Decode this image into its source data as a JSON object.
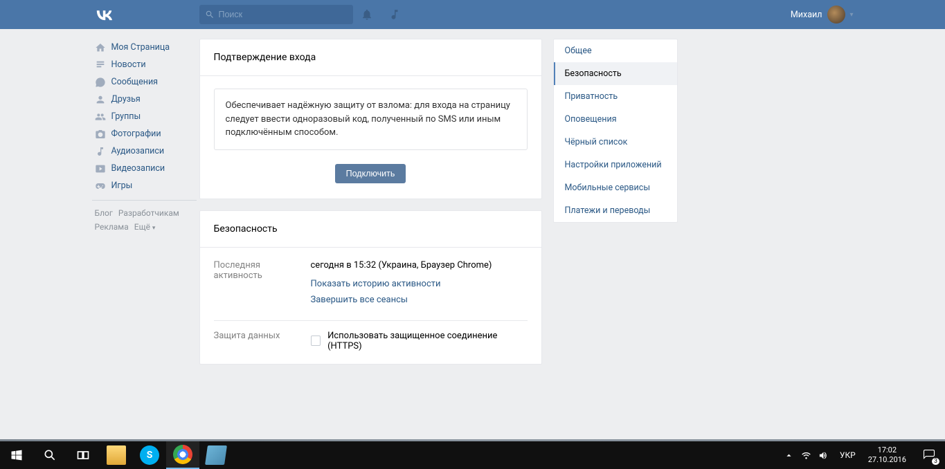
{
  "header": {
    "search_placeholder": "Поиск",
    "username": "Михаил"
  },
  "nav": {
    "items": [
      {
        "icon": "home",
        "label": "Моя Страница"
      },
      {
        "icon": "news",
        "label": "Новости"
      },
      {
        "icon": "msg",
        "label": "Сообщения"
      },
      {
        "icon": "friends",
        "label": "Друзья"
      },
      {
        "icon": "groups",
        "label": "Группы"
      },
      {
        "icon": "photos",
        "label": "Фотографии"
      },
      {
        "icon": "audio",
        "label": "Аудиозаписи"
      },
      {
        "icon": "video",
        "label": "Видеозаписи"
      },
      {
        "icon": "games",
        "label": "Игры"
      }
    ]
  },
  "footer_links": {
    "blog": "Блог",
    "dev": "Разработчикам",
    "ads": "Реклама",
    "more": "Ещё"
  },
  "main": {
    "panel1": {
      "title": "Подтверждение входа",
      "info": "Обеспечивает надёжную защиту от взлома: для входа на страницу следует ввести одноразовый код, полученный по SMS или иным подключённым способом.",
      "button": "Подключить"
    },
    "panel2": {
      "title": "Безопасность",
      "row1_label": "Последняя активность",
      "row1_value": "сегодня в 15:32 (Украина, Браузер Chrome)",
      "link_history": "Показать историю активности",
      "link_end": "Завершить все сеансы",
      "row2_label": "Защита данных",
      "row2_checkbox": "Использовать защищенное соединение (HTTPS)"
    }
  },
  "tabs": [
    {
      "label": "Общее",
      "active": false
    },
    {
      "label": "Безопасность",
      "active": true
    },
    {
      "label": "Приватность",
      "active": false
    },
    {
      "label": "Оповещения",
      "active": false
    },
    {
      "label": "Чёрный список",
      "active": false
    },
    {
      "label": "Настройки приложений",
      "active": false
    },
    {
      "label": "Мобильные сервисы",
      "active": false
    },
    {
      "label": "Платежи и переводы",
      "active": false
    }
  ],
  "taskbar": {
    "lang": "УКР",
    "time": "17:02",
    "date": "27.10.2016",
    "notif_count": "3"
  }
}
